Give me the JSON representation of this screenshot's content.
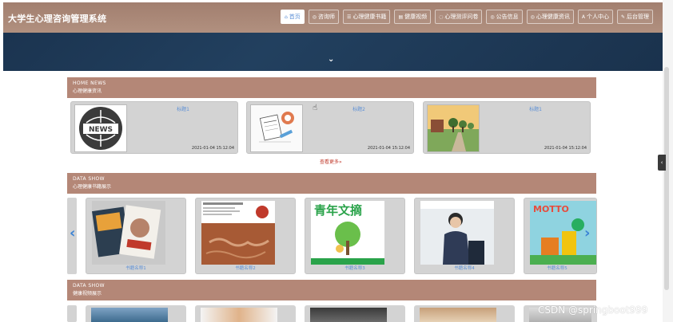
{
  "app": {
    "title": "大学生心理咨询管理系统"
  },
  "nav": {
    "items": [
      {
        "icon": "home-icon",
        "label": "首页",
        "active": true
      },
      {
        "icon": "chat-icon",
        "label": "咨询师",
        "active": false
      },
      {
        "icon": "book-icon",
        "label": "心理健康书籍",
        "active": false
      },
      {
        "icon": "video-icon",
        "label": "健康视频",
        "active": false
      },
      {
        "icon": "test-icon",
        "label": "心理测评问卷",
        "active": false
      },
      {
        "icon": "notice-icon",
        "label": "公告信息",
        "active": false
      },
      {
        "icon": "news-icon",
        "label": "心理健康资讯",
        "active": false
      },
      {
        "icon": "user-icon",
        "label": "个人中心",
        "active": false
      },
      {
        "icon": "admin-icon",
        "label": "后台管理",
        "active": false
      }
    ]
  },
  "sections": {
    "news": {
      "en": "HOME NEWS",
      "cn": "心理健康资讯"
    },
    "books": {
      "en": "DATA SHOW",
      "cn": "心理健康书籍展示"
    },
    "videos": {
      "en": "DATA SHOW",
      "cn": "健康视频展示"
    }
  },
  "news": [
    {
      "title": "标题1",
      "date": "2021-01-04 15:12:04",
      "thumb": "news-globe-image"
    },
    {
      "title": "标题2",
      "date": "2021-01-04 15:12:04",
      "thumb": "newspaper-image"
    },
    {
      "title": "标题1",
      "date": "2021-01-04 15:12:04",
      "thumb": "campus-image"
    }
  ],
  "more_label": "查看更多»",
  "books": [
    {
      "name": "书籍名称1",
      "cover": "magazines-cover"
    },
    {
      "name": "书籍名称2",
      "cover": "brown-map-cover"
    },
    {
      "name": "书籍名称3",
      "cover": "youth-digest-cover"
    },
    {
      "name": "书籍名称4",
      "cover": "portrait-cover"
    },
    {
      "name": "书籍名称5",
      "cover": "motto-cover"
    }
  ],
  "book_covers": {
    "cover3_title": "青年文摘",
    "cover5_title": "MOTTO"
  },
  "watermark": "CSDN @springboot999",
  "colors": {
    "header": "#b1907f",
    "section": "#b48777",
    "link": "#5b8fd6",
    "hero": "#1f3a58",
    "more": "#c0392b"
  }
}
